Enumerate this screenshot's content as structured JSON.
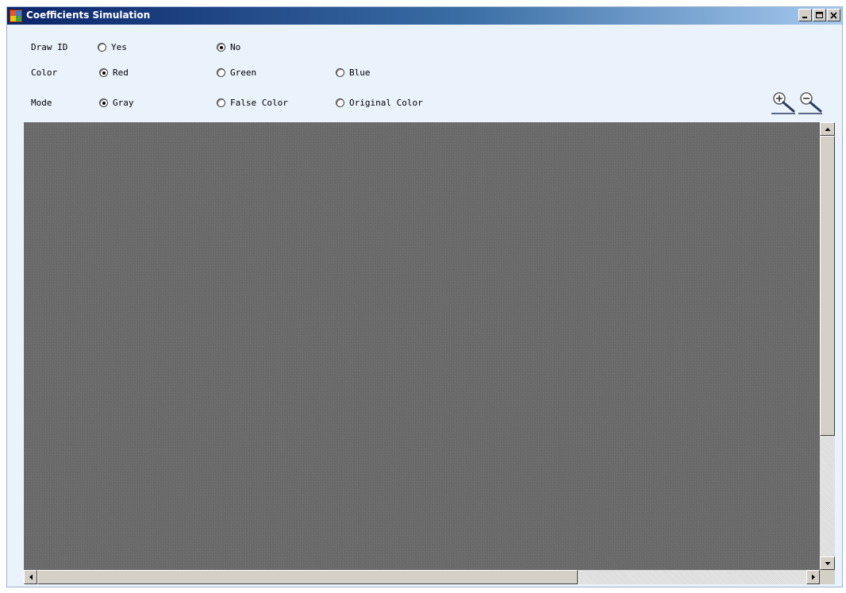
{
  "window": {
    "title": "Coefficients Simulation",
    "controls": [
      "minimize-icon",
      "maximize-icon",
      "close-icon"
    ]
  },
  "options": {
    "draw_id": {
      "label": "Draw ID",
      "choices": [
        "Yes",
        "No"
      ],
      "selected": "No"
    },
    "color": {
      "label": "Color",
      "choices": [
        "Red",
        "Green",
        "Blue"
      ],
      "selected": "Red"
    },
    "mode": {
      "label": "Mode",
      "choices": [
        "Gray",
        "False Color",
        "Original Color"
      ],
      "selected": "Gray"
    }
  },
  "toolbar": {
    "zoom_in_icon": "zoom-in-icon",
    "zoom_out_icon": "zoom-out-icon"
  },
  "colors": {
    "title_start": "#0a246a",
    "title_end": "#a6caf0",
    "background": "#eaf2fb",
    "image_gray": "#6b6b6b"
  }
}
